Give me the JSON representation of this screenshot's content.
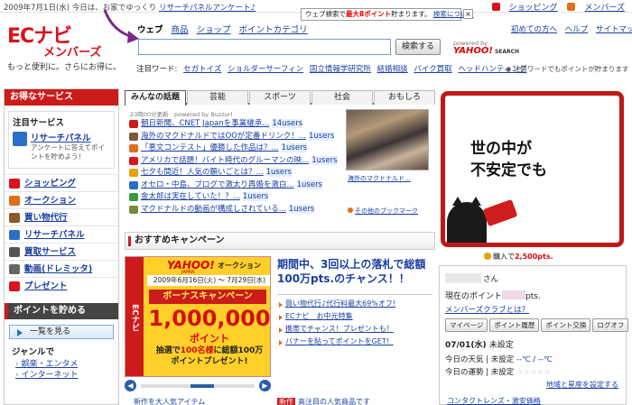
{
  "topbar": {
    "news": "2009年7月1日(水) 今日は、お家でゆっくり",
    "news_link": "リサーチパネルアンケート♪",
    "shopping": "ショッピング",
    "members": "メンバーズ"
  },
  "logo": {
    "main": "ECナビ",
    "sub": "メンバーズ",
    "tagline": "もっと便利に。さらにお得に。"
  },
  "search": {
    "tabs": [
      "ウェブ",
      "商品",
      "ショップ",
      "ポイントカテゴリ"
    ],
    "input_value": "",
    "button_label": "検索する",
    "powered_by": "powered by",
    "provider": "YAHOO!",
    "provider_sub": "SEARCH",
    "tooltip_prefix": "ウェブ検索で",
    "tooltip_highlight": "最大8ポイント",
    "tooltip_suffix": "貯まります。",
    "tooltip_link": "検索について",
    "tooltip_close": "×"
  },
  "header_links": [
    "初めての方へ",
    "ヘルプ",
    "サイトマップ"
  ],
  "hot_words": {
    "label": "注目ワード:",
    "words": [
      "セガトイズ",
      "ショルダーサーフィン",
      "国立情報学研究所",
      "結婚相談",
      "バイク買取",
      "ヘッドハンティング"
    ],
    "note": "注目ワードでもポイントが貯まります"
  },
  "sidebar": {
    "head": "お得なサービス",
    "attention_head": "注目サービス",
    "attention_title": "リサーチパネル",
    "attention_desc": "アンケートに答えてポイントを貯めよう！",
    "services": [
      {
        "label": "ショッピング",
        "color": "#d8131b"
      },
      {
        "label": "オークション",
        "color": "#e07018"
      },
      {
        "label": "買い物代行",
        "color": "#8a5a2a"
      },
      {
        "label": "リサーチパネル",
        "color": "#2a6ec7"
      },
      {
        "label": "買取サービス",
        "color": "#555555"
      },
      {
        "label": "動画(ドレミッタ)",
        "color": "#666666"
      },
      {
        "label": "プレゼント",
        "color": "#d8131b"
      }
    ],
    "points_head": "ポイントを貯める",
    "list_button": "一覧を見る",
    "genre_head": "ジャンルで",
    "genres": [
      "娯楽・エンタメ",
      "インターネット"
    ]
  },
  "news": {
    "tabs": [
      "みんなの話題",
      "芸能",
      "スポーツ",
      "社会",
      "おもしろ"
    ],
    "meta": "23時00分更新　powered by Buzzurl",
    "items": [
      {
        "text": "朝日新聞、CNET Japanを事業継承...",
        "users": "14users",
        "color": "#cc1b1b"
      },
      {
        "text": "海外のマクドナルドではOOが定番ドリンク！...",
        "users": "1users",
        "color": "#7a5a3a"
      },
      {
        "text": "「悪文コンテスト」優勝した作品は？...",
        "users": "1users",
        "color": "#e07018"
      },
      {
        "text": "アメリカで話題！バイト時代のグルーマンの映...",
        "users": "1users",
        "color": "#d8131b"
      },
      {
        "text": "七夕も間近！人気の願いごとは？...",
        "users": "1users",
        "color": "#e3a300"
      },
      {
        "text": "オセロ・中島、ブログで激太り再婚を激白...",
        "users": "1users",
        "color": "#2a6ec7"
      },
      {
        "text": "金太郎は実在していた！？...",
        "users": "1users",
        "color": "#3a9a3a"
      },
      {
        "text": "マクドナルドの動画が構成しされている...",
        "users": "1users",
        "color": "#7a8a3a"
      }
    ],
    "photo_caption": "海外のマクドナルド...",
    "more_bookmarks": "その他のブックマーク"
  },
  "campaign": {
    "head": "おすすめキャンペーン",
    "banner": {
      "side": "ECナビ",
      "brand": "YAHOO!",
      "brand_sub": "JAPAN",
      "service": "オークション",
      "date": "2009年6月16日(火) 〜 7月29日(水)",
      "bonus": "ボーナスキャンペーン",
      "amount": "1,000,000",
      "unit": "ポイント",
      "lottery_1": "抽選で",
      "lottery_hl": "100名様",
      "lottery_2": "に総額100万",
      "lottery_3": "ポイントプレゼント!"
    },
    "carousel": {
      "prev": "◀",
      "next": "▶",
      "position": 0.55
    },
    "title": "期間中、3回以上の落札で総額100万pts.のチャンス！！",
    "links": [
      "買い物代行♪代行料最大69%オフ!",
      "ECナビ　お中元特集",
      "携帯でチャンス！プレゼントも！",
      "バナーを貼ってポイントをGET！"
    ],
    "bottom_left": "新作を大人気アイテム",
    "bottom_badge": "新作",
    "bottom_right": "高注目の人気商品です"
  },
  "ad": {
    "line1": "世の中が",
    "line2": "不安定でも"
  },
  "purchase": {
    "label": "購入で",
    "value": "2,500pts."
  },
  "member": {
    "suffix": "さん",
    "points_label": "現在のポイント",
    "points_unit": "pts.",
    "club": "メンバーズクラブとは？",
    "buttons": [
      "マイページ",
      "ポイント履歴",
      "ポイント交換",
      "ログオフ"
    ],
    "date": "07/01(水)",
    "status": "未設定",
    "weather_label": "今日の天気",
    "weather_value": "未設定",
    "temp": "--℃ / --℃",
    "fortune_label": "今日の運勢",
    "fortune_value": "未設定",
    "stars": "☆☆☆☆☆",
    "settings_link": "地域と星座を設定する",
    "peek": "コンタクトレンズ・激安価格"
  }
}
